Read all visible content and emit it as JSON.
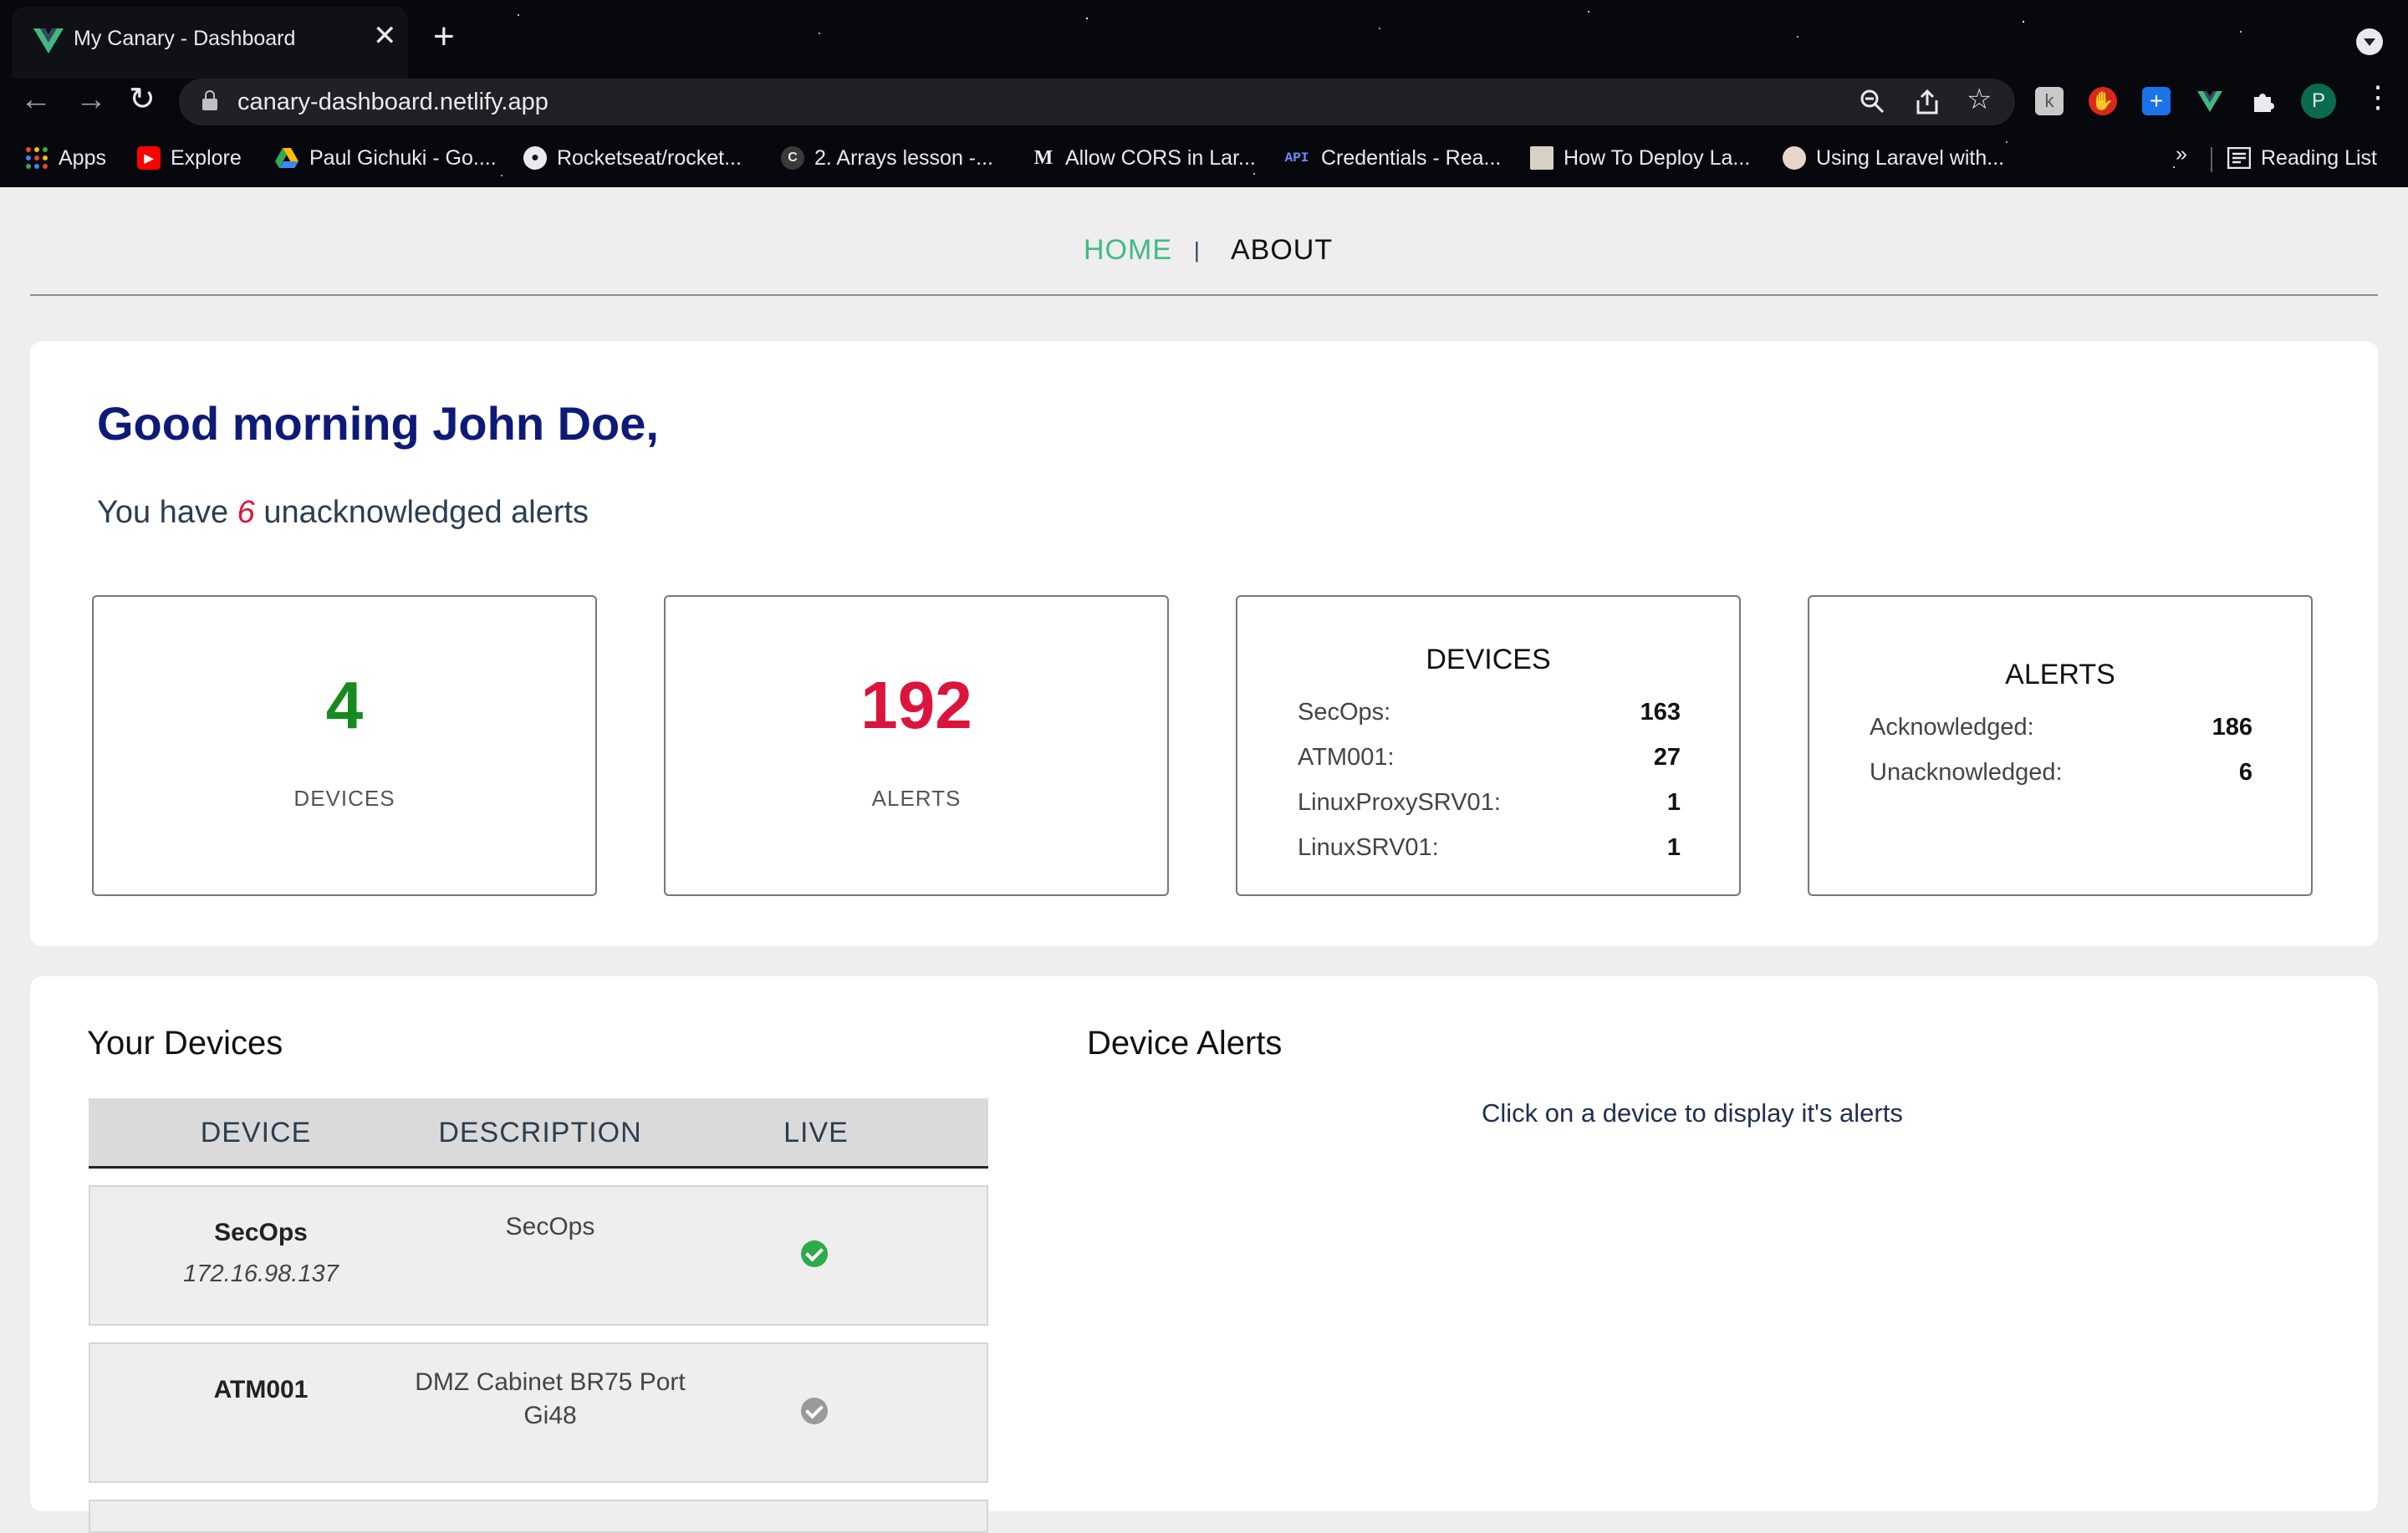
{
  "browser": {
    "tab_title": "My Canary - Dashboard",
    "new_tab_symbol": "+",
    "close_symbol": "✕",
    "url": "canary-dashboard.netlify.app",
    "avatar_initial": "P",
    "bookmarks": [
      {
        "label": "Apps",
        "icon": "apps-grid-icon"
      },
      {
        "label": "Explore",
        "icon": "youtube-icon"
      },
      {
        "label": "Paul Gichuki - Go....",
        "icon": "google-drive-icon"
      },
      {
        "label": "Rocketseat/rocket...",
        "icon": "github-icon"
      },
      {
        "label": "2. Arrays lesson -...",
        "icon": "codecademy-icon"
      },
      {
        "label": "Allow CORS in Lar...",
        "icon": "medium-icon"
      },
      {
        "label": "Credentials - Rea...",
        "icon": "api-icon"
      },
      {
        "label": "How To Deploy La...",
        "icon": "page-icon"
      },
      {
        "label": "Using Laravel with...",
        "icon": "avatar-icon"
      }
    ],
    "bookmarks_overflow": "»",
    "reading_list": "Reading List"
  },
  "nav": {
    "home": "HOME",
    "divider": "|",
    "about": "ABOUT"
  },
  "greeting": {
    "title": "Good morning John Doe,",
    "prefix": "You have",
    "unack_count": "6",
    "suffix": "unacknowledged alerts"
  },
  "stats": {
    "devices_count": "4",
    "devices_label": "DEVICES",
    "alerts_count": "192",
    "alerts_label": "ALERTS"
  },
  "device_breakdown": {
    "title": "DEVICES",
    "rows": [
      {
        "name": "SecOps:",
        "count": "163"
      },
      {
        "name": "ATM001:",
        "count": "27"
      },
      {
        "name": "LinuxProxySRV01:",
        "count": "1"
      },
      {
        "name": "LinuxSRV01:",
        "count": "1"
      }
    ]
  },
  "alert_breakdown": {
    "title": "ALERTS",
    "rows": [
      {
        "name": "Acknowledged:",
        "count": "186"
      },
      {
        "name": "Unacknowledged:",
        "count": "6"
      }
    ]
  },
  "your_devices": {
    "title": "Your Devices",
    "columns": [
      "DEVICE",
      "DESCRIPTION",
      "LIVE"
    ],
    "rows": [
      {
        "name": "SecOps",
        "ip": "172.16.98.137",
        "description": "SecOps",
        "live": true
      },
      {
        "name": "ATM001",
        "ip": "",
        "description": "DMZ Cabinet BR75 Port Gi48",
        "live": false
      }
    ]
  },
  "device_alerts": {
    "title": "Device Alerts",
    "hint": "Click on a device to display it's alerts"
  },
  "colors": {
    "accent_green": "#42b983",
    "greeting_navy": "#0d1a78",
    "devices_green": "#178a1f",
    "alerts_red": "#dc143c",
    "live_green": "#2eaa4a",
    "offline_grey": "#9a9a9a"
  }
}
